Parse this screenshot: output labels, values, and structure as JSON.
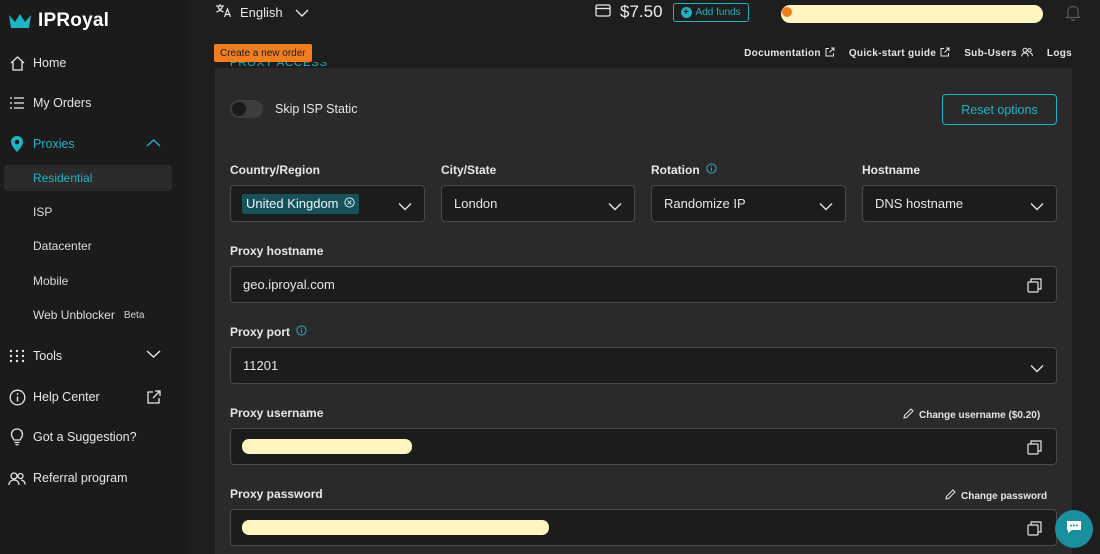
{
  "brand": {
    "name": "IPRoyal"
  },
  "colors": {
    "accent": "#1fb3c4",
    "orange": "#f07d1f",
    "redact": "#fff5c0"
  },
  "sidebar": {
    "items": [
      {
        "label": "Home",
        "icon": "home-icon"
      },
      {
        "label": "My Orders",
        "icon": "list-icon"
      },
      {
        "label": "Proxies",
        "icon": "location-pin-icon"
      },
      {
        "label": "Tools",
        "icon": "grid-dots-icon"
      },
      {
        "label": "Help Center",
        "icon": "info-icon"
      },
      {
        "label": "Got a Suggestion?",
        "icon": "lightbulb-icon"
      },
      {
        "label": "Referral program",
        "icon": "users-icon"
      }
    ],
    "proxy_subitems": [
      {
        "label": "Residential"
      },
      {
        "label": "ISP"
      },
      {
        "label": "Datacenter"
      },
      {
        "label": "Mobile"
      },
      {
        "label": "Web Unblocker",
        "badge": "Beta"
      }
    ]
  },
  "topbar": {
    "language": "English",
    "balance": "$7.50",
    "add_funds": "Add funds"
  },
  "subbar": {
    "create_order": "Create a new order",
    "links": [
      "Documentation",
      "Quick-start guide",
      "Sub-Users",
      "Logs"
    ]
  },
  "panel": {
    "partial_heading": "PROXY ACCESS",
    "skip_isp_label": "Skip ISP Static",
    "skip_isp_on": false,
    "reset_label": "Reset options",
    "country": {
      "label": "Country/Region",
      "value": "United Kingdom"
    },
    "city": {
      "label": "City/State",
      "value": "London"
    },
    "rotation": {
      "label": "Rotation",
      "value": "Randomize IP"
    },
    "hostname_type": {
      "label": "Hostname",
      "value": "DNS hostname"
    },
    "proxy_hostname": {
      "label": "Proxy hostname",
      "value": "geo.iproyal.com"
    },
    "proxy_port": {
      "label": "Proxy port",
      "value": "11201"
    },
    "proxy_username": {
      "label": "Proxy username",
      "change": "Change username ($0.20)"
    },
    "proxy_password": {
      "label": "Proxy password",
      "change": "Change password"
    }
  }
}
